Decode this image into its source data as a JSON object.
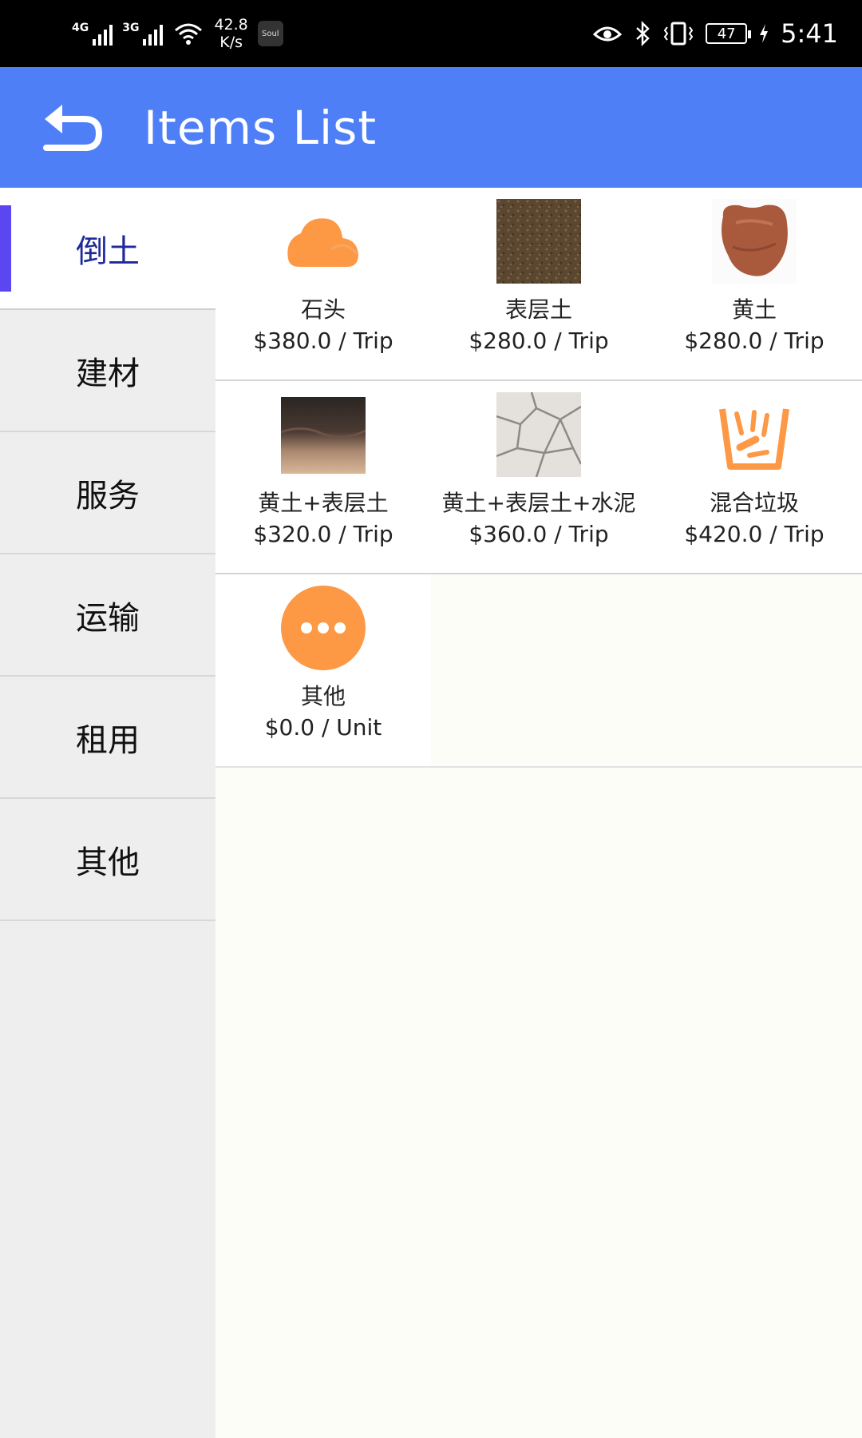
{
  "status_bar": {
    "signal_1": "4G",
    "signal_2": "3G",
    "network_speed_value": "42.8",
    "network_speed_unit": "K/s",
    "app_badge": "Soul",
    "battery_level": "47",
    "time": "5:41"
  },
  "app_bar": {
    "title": "Items List",
    "back_icon": "back-arrow-icon"
  },
  "sidebar": {
    "selected_index": 0,
    "items": [
      {
        "label": "倒土"
      },
      {
        "label": "建材"
      },
      {
        "label": "服务"
      },
      {
        "label": "运输"
      },
      {
        "label": "租用"
      },
      {
        "label": "其他"
      }
    ]
  },
  "items": [
    {
      "name": "石头",
      "price": "$380.0 / Trip",
      "icon": "rock-icon"
    },
    {
      "name": "表层土",
      "price": "$280.0 / Trip",
      "icon": "topsoil-image"
    },
    {
      "name": "黄土",
      "price": "$280.0 / Trip",
      "icon": "yellow-soil-image"
    },
    {
      "name": "黄土+表层土",
      "price": "$320.0 / Trip",
      "icon": "soil-layers-image"
    },
    {
      "name": "黄土+表层土+水泥",
      "price": "$360.0 / Trip",
      "icon": "cracked-concrete-image"
    },
    {
      "name": "混合垃圾",
      "price": "$420.0 / Trip",
      "icon": "mixed-waste-icon"
    },
    {
      "name": "其他",
      "price": "$0.0 / Unit",
      "icon": "more-dots-icon"
    }
  ],
  "colors": {
    "app_bar": "#4f7ff7",
    "accent_orange": "#fd9845",
    "sidebar_active_text": "#1f2a99",
    "sidebar_indicator": "#5b46f2",
    "sidebar_bg": "#eeeeee"
  }
}
